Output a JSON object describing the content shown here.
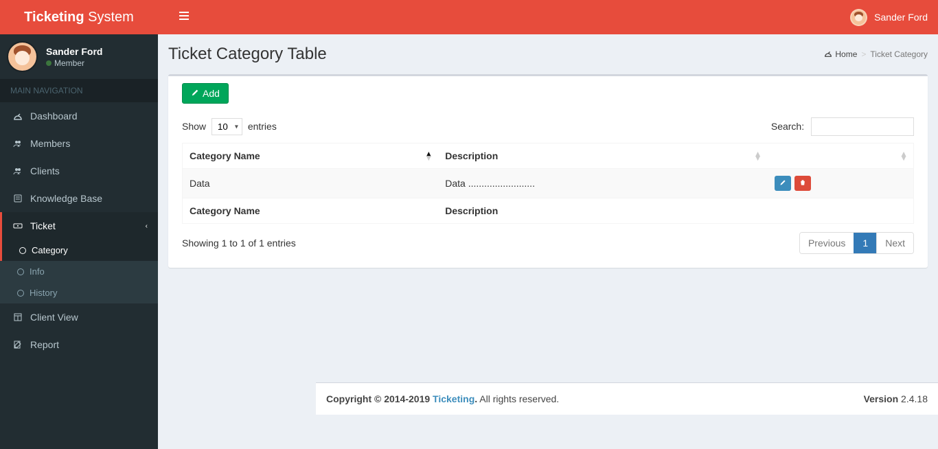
{
  "brand": {
    "bold": "Ticketing",
    "light": " System"
  },
  "user": {
    "name": "Sander Ford",
    "role": "Member"
  },
  "sidebar": {
    "header": "MAIN NAVIGATION",
    "items": [
      {
        "label": "Dashboard"
      },
      {
        "label": "Members"
      },
      {
        "label": "Clients"
      },
      {
        "label": "Knowledge Base"
      },
      {
        "label": "Ticket"
      },
      {
        "label": "Client View"
      },
      {
        "label": "Report"
      }
    ],
    "ticket_sub": [
      {
        "label": "Category"
      },
      {
        "label": "Info"
      },
      {
        "label": "History"
      }
    ]
  },
  "page": {
    "title": "Ticket Category Table",
    "breadcrumb_home": "Home",
    "breadcrumb_active": "Ticket Category"
  },
  "actions": {
    "add": "Add"
  },
  "datatable": {
    "show_label": "Show",
    "entries_label": "entries",
    "page_size": "10",
    "search_label": "Search:",
    "search_value": "",
    "columns": {
      "name": "Category Name",
      "desc": "Description",
      "actions": ""
    },
    "rows": [
      {
        "name": "Data",
        "desc": "Data ........................."
      }
    ],
    "info": "Showing 1 to 1 of 1 entries",
    "prev": "Previous",
    "next": "Next",
    "page": "1"
  },
  "footer": {
    "copyright_prefix": "Copyright © 2014-2019 ",
    "link": "Ticketing",
    "copyright_suffix": " All rights reserved.",
    "version_label": "Version",
    "version": " 2.4.18"
  }
}
